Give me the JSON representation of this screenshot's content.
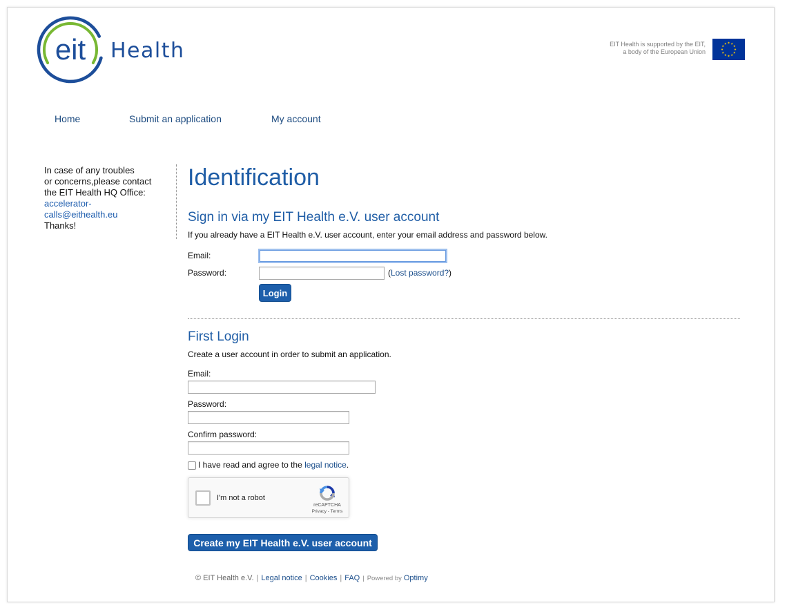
{
  "header": {
    "logo_text": "eit",
    "brand_name": "Health",
    "eu_notice_lines": [
      "EIT Health is supported by the EIT,",
      "a body of the European Union"
    ]
  },
  "nav": {
    "items": [
      {
        "label": "Home"
      },
      {
        "label": "Submit an application"
      },
      {
        "label": "My account"
      }
    ]
  },
  "sidebar": {
    "note_lines": [
      "In case of any troubles",
      "or concerns,please contact",
      "the EIT Health HQ Office:"
    ],
    "contact_email": "accelerator-calls@eithealth.eu",
    "thanks": "Thanks!"
  },
  "main": {
    "title": "Identification",
    "signin": {
      "heading": "Sign in via my EIT Health e.V. user account",
      "intro": "If you already have a EIT Health e.V. user account, enter your email address and password below.",
      "email_label": "Email:",
      "email_value": "",
      "password_label": "Password:",
      "password_value": "",
      "lost_password_open": "(",
      "lost_password_link": "Lost password?",
      "lost_password_close": ")",
      "login_button": "Login"
    },
    "first_login": {
      "heading": "First Login",
      "intro": "Create a user account in order to submit an application.",
      "email_label": "Email:",
      "email_value": "",
      "password_label": "Password:",
      "password_value": "",
      "confirm_label": "Confirm password:",
      "confirm_value": "",
      "agree_text": "I have read and agree to the ",
      "agree_link": "legal notice",
      "agree_end": ".",
      "recaptcha": {
        "label": "I'm not a robot",
        "brand": "reCAPTCHA",
        "privacy_link": "Privacy",
        "separator": " - ",
        "terms_link": "Terms"
      },
      "create_button": "Create my EIT Health e.V. user account"
    }
  },
  "footer": {
    "copyright": "© EIT Health e.V.",
    "separator": "|",
    "links": [
      "Legal notice",
      "Cookies",
      "FAQ"
    ],
    "powered_by": "Powered by",
    "powered_link": "Optimy"
  },
  "icons": {
    "logo": "eit-logo-icon",
    "eu_flag": "eu-flag-icon",
    "recaptcha": "recaptcha-logo-icon",
    "recaptcha_checkbox": "checkbox-icon"
  },
  "colors": {
    "brand_blue": "#1d4e9a",
    "brand_green": "#78b833",
    "heading_blue": "#1f5da6",
    "link_blue": "#1c4f8c",
    "nav_blue": "#1d4b80",
    "button_blue": "#1d5fab",
    "email_blue": "#1b5bad",
    "eu_blue": "#003399",
    "eu_gold": "#ffcc00"
  }
}
